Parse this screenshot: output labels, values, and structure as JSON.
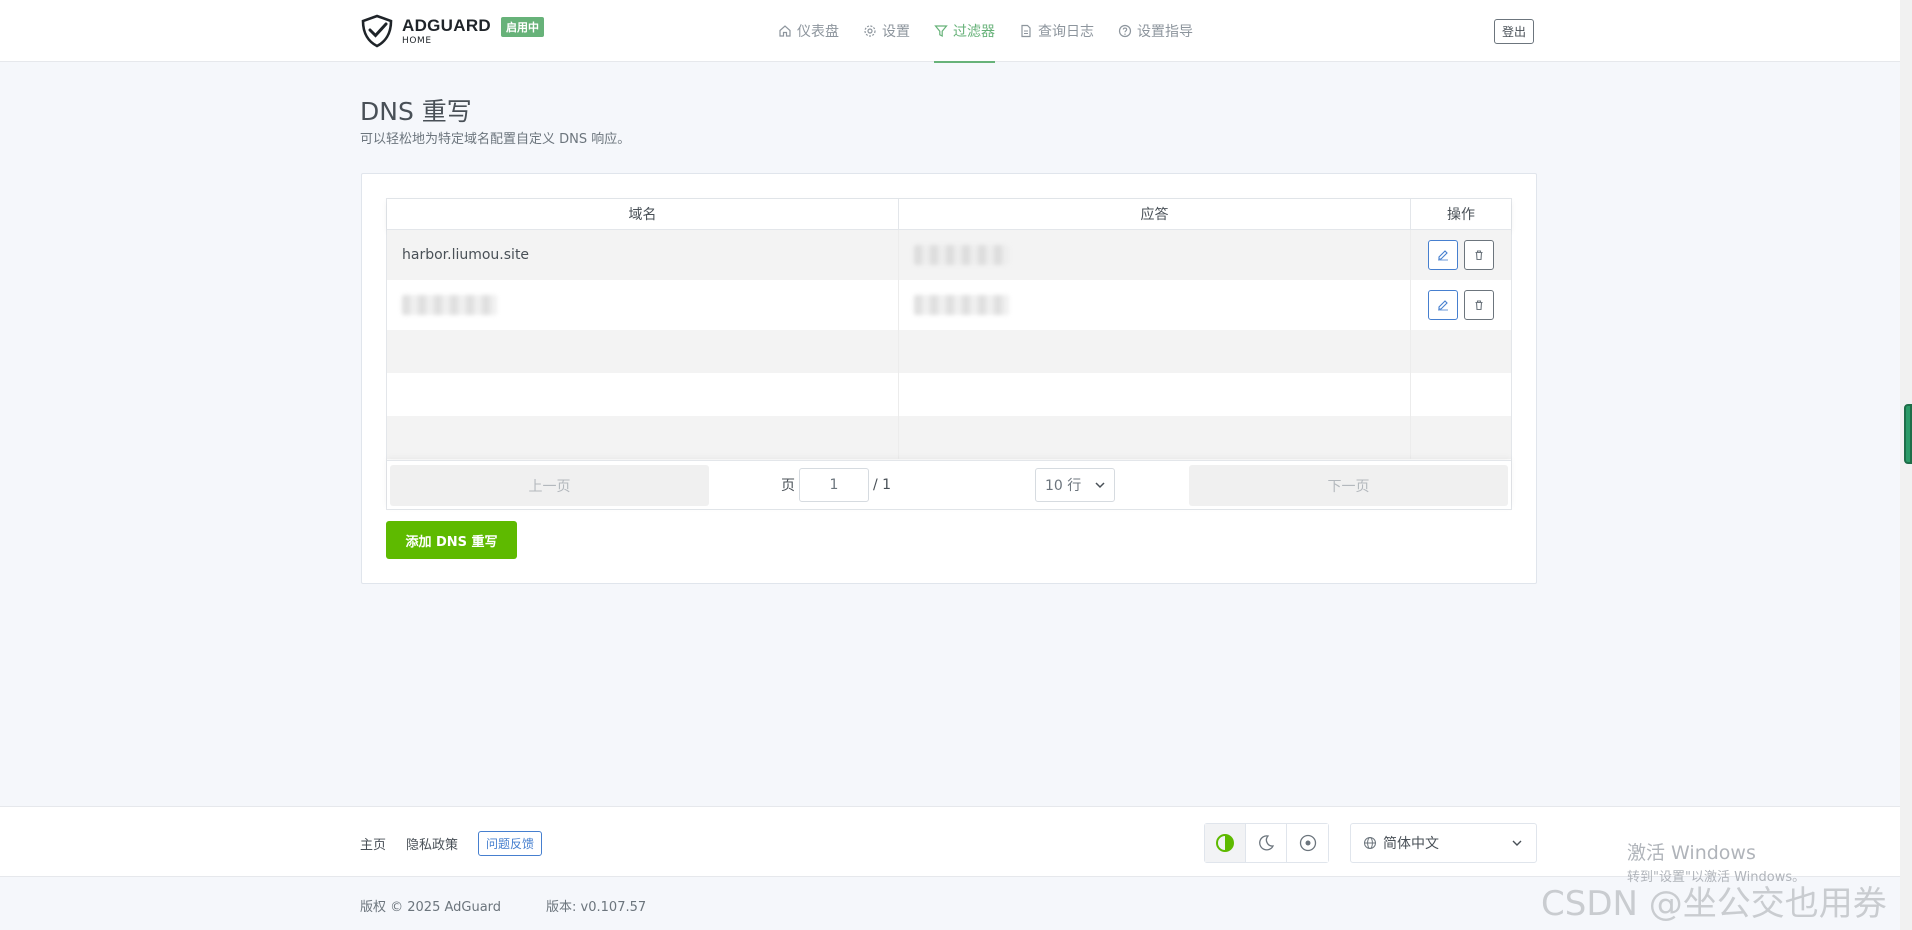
{
  "header": {
    "brand": "ADGUARD",
    "brand_sub": "HOME",
    "status_badge": "启用中",
    "nav": [
      {
        "label": "仪表盘",
        "icon": "home-icon",
        "active": false
      },
      {
        "label": "设置",
        "icon": "gear-icon",
        "active": false
      },
      {
        "label": "过滤器",
        "icon": "filter-icon",
        "active": true
      },
      {
        "label": "查询日志",
        "icon": "document-icon",
        "active": false
      },
      {
        "label": "设置指导",
        "icon": "help-circle-icon",
        "active": false
      }
    ],
    "logout_label": "登出"
  },
  "page": {
    "title": "DNS 重写",
    "description": "可以轻松地为特定域名配置自定义 DNS 响应。"
  },
  "table": {
    "columns": [
      "域名",
      "应答",
      "操作"
    ],
    "rows": [
      {
        "domain": "harbor.liumou.site",
        "answer": "",
        "domain_redacted": false,
        "answer_redacted": true
      },
      {
        "domain": "",
        "answer": "",
        "domain_redacted": true,
        "answer_redacted": true
      }
    ],
    "pagination": {
      "prev_label": "上一页",
      "next_label": "下一页",
      "page_label": "页",
      "page_value": "1",
      "total_pages": "/ 1",
      "rows_per_page": "10 行"
    }
  },
  "add_button_label": "添加 DNS 重写",
  "footer": {
    "links": [
      "主页",
      "隐私政策"
    ],
    "feedback_label": "问题反馈",
    "theme_options": [
      "auto-theme-icon",
      "moon-icon",
      "sun-icon"
    ],
    "language": "简体中文",
    "copyright": "版权 © 2025 AdGuard",
    "version": "版本: v0.107.57"
  },
  "watermarks": {
    "windows_title": "激活 Windows",
    "windows_sub": "转到\"设置\"以激活 Windows。",
    "csdn": "CSDN @坐公交也用券"
  },
  "colors": {
    "accent": "#67b279",
    "primary_green": "#5eba00",
    "link_blue": "#467fcf"
  }
}
